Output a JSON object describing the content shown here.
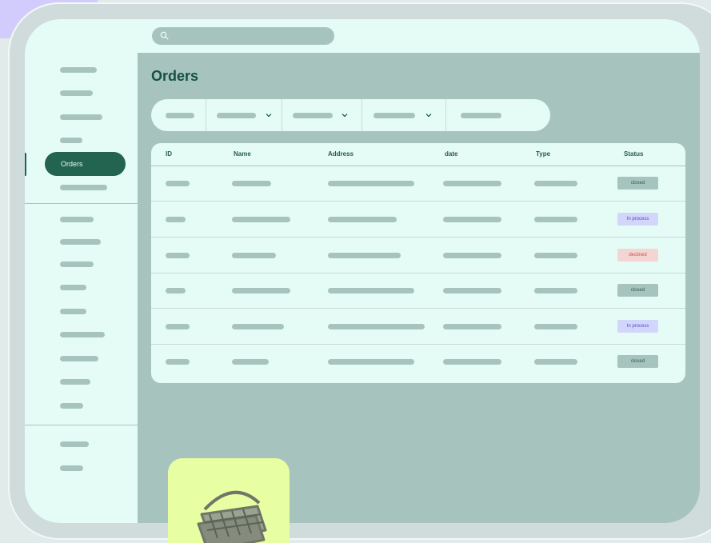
{
  "main": {
    "title": "Orders"
  },
  "sidebar": {
    "active_label": "Orders"
  },
  "table": {
    "columns": [
      "ID",
      "Name",
      "Address",
      "date",
      "Type",
      "Status"
    ],
    "statuses": [
      "closed",
      "In process",
      "declined",
      "closed",
      "In process",
      "closed"
    ]
  },
  "colors": {
    "accent": "#236450",
    "background": "#a6c4bd",
    "surface": "#e5fcf6",
    "badge_closed": "#a6c4bd",
    "badge_in_process": "#d3d6fb",
    "badge_declined": "#f3d6d3"
  },
  "icons": {
    "search": "search-icon",
    "dropdown": "chevron-down-icon",
    "basket": "basket-icon"
  }
}
